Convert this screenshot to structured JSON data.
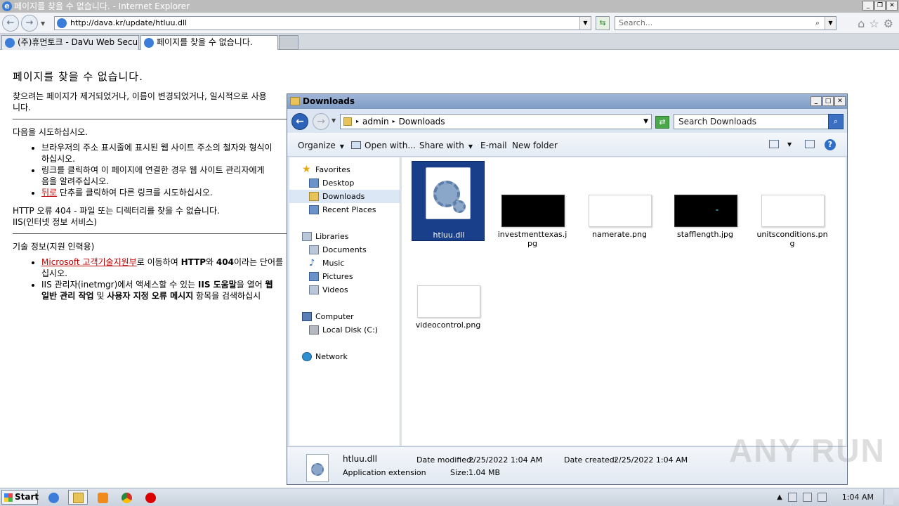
{
  "ie": {
    "window_title": "페이지를 찾을 수 없습니다. - Internet Explorer",
    "address": "http://dava.kr/update/htluu.dll",
    "search_placeholder": "Search...",
    "tabs": [
      {
        "label": "(주)휴먼토크 - DaVu Web Secu..."
      },
      {
        "label": "페이지를 찾을 수 없습니다."
      }
    ]
  },
  "page": {
    "heading": "페이지를 찾을 수 없습니다.",
    "intro_line1": "찾으려는 페이지가 제거되었거나, 이름이 변경되었거나, 일시적으로 사용",
    "intro_line2": "니다.",
    "try_heading": "다음을 시도하십시오.",
    "bullet1_line1": "브라우저의 주소 표시줄에 표시된 웹 사이트 주소의 철자와 형식이",
    "bullet1_line2": "하십시오.",
    "bullet2_line1": "링크를 클릭하여 이 페이지에 연결한 경우 웹 사이트 관리자에게",
    "bullet2_line2": "음을 알려주십시오.",
    "bullet3_link": "뒤로",
    "bullet3_rest": " 단추를 클릭하여 다른 링크를 시도하십시오.",
    "error_line": "HTTP 오류 404 - 파일 또는 디렉터리를 찾을 수 없습니다.",
    "iis_line": "IIS(인터넷 정보 서비스)",
    "tech_heading": "기술 정보(지원 인력용)",
    "tech1_link": "Microsoft 고객기술지원부",
    "tech1_rest_a": "로 이동하여 ",
    "tech1_bold1": "HTTP",
    "tech1_rest_b": "와 ",
    "tech1_bold2": "404",
    "tech1_rest_c": "이라는 단어를",
    "tech1_line2": "십시오.",
    "tech2_a": "IIS 관리자(inetmgr)에서 액세스할 수 있는 ",
    "tech2_bold1": "IIS 도움말",
    "tech2_b": "을 열어 ",
    "tech2_bold2": "웹",
    "tech2_line2_bold1": "일반 관리 작업",
    "tech2_line2_b": " 및 ",
    "tech2_line2_bold2": "사용자 지정 오류 메시지",
    "tech2_line2_c": " 항목을 검색하십시"
  },
  "explorer": {
    "title": "Downloads",
    "breadcrumb": [
      "admin",
      "Downloads"
    ],
    "search_placeholder": "Search Downloads",
    "commands": {
      "organize": "Organize",
      "open_with": "Open with...",
      "share_with": "Share with",
      "email": "E-mail",
      "new_folder": "New folder"
    },
    "nav": {
      "favorites": "Favorites",
      "desktop": "Desktop",
      "downloads": "Downloads",
      "recent": "Recent Places",
      "libraries": "Libraries",
      "documents": "Documents",
      "music": "Music",
      "pictures": "Pictures",
      "videos": "Videos",
      "computer": "Computer",
      "local_disk": "Local Disk (C:)",
      "network": "Network"
    },
    "files": [
      {
        "name": "htluu.dll"
      },
      {
        "name": "investmenttexas.jpg"
      },
      {
        "name": "namerate.png"
      },
      {
        "name": "stafflength.jpg"
      },
      {
        "name": "unitsconditions.png"
      },
      {
        "name": "videocontrol.png"
      }
    ],
    "details": {
      "name": "htluu.dll",
      "type": "Application extension",
      "date_modified_label": "Date modified:",
      "date_modified": "2/25/2022 1:04 AM",
      "size_label": "Size:",
      "size": "1.04 MB",
      "date_created_label": "Date created:",
      "date_created": "2/25/2022 1:04 AM"
    }
  },
  "taskbar": {
    "start": "Start",
    "clock": "1:04 AM"
  },
  "watermark": "ANY RUN"
}
